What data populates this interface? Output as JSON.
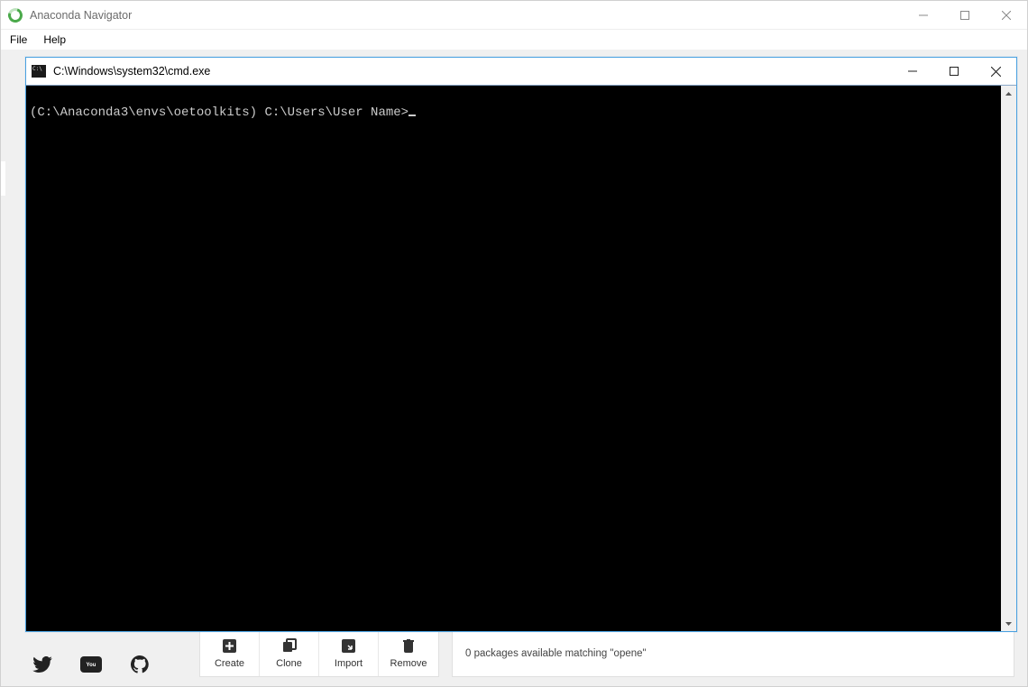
{
  "navigator": {
    "title": "Anaconda Navigator",
    "menu": {
      "file": "File",
      "help": "Help"
    },
    "env_actions": {
      "create": "Create",
      "clone": "Clone",
      "import": "Import",
      "remove": "Remove"
    },
    "pkg_status": "0 packages available matching \"opene\""
  },
  "cmd": {
    "title": "C:\\Windows\\system32\\cmd.exe",
    "prompt": "(C:\\Anaconda3\\envs\\oetoolkits) C:\\Users\\User Name>"
  }
}
